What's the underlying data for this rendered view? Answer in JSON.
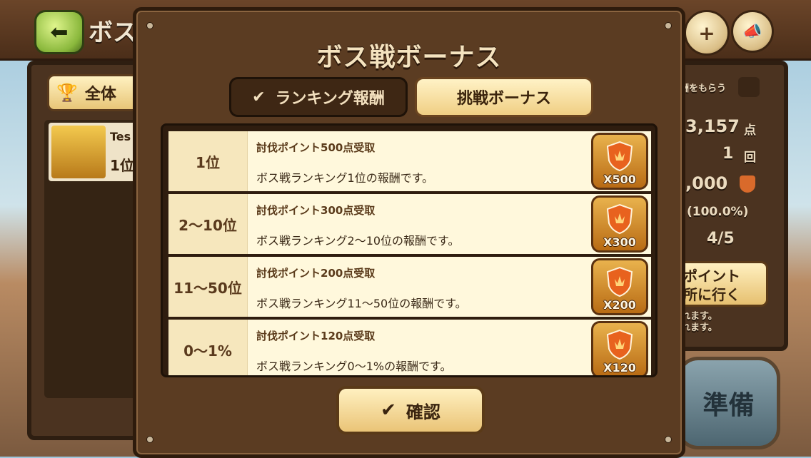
{
  "background": {
    "title_partial": "ボス",
    "left_tab_partial": "全体",
    "user_name_partial": "Tes",
    "user_rank_partial": "1位",
    "right_panel": {
      "receive_reward_partial": "酬をもらう",
      "score_partial": "3,157",
      "score_unit": "点",
      "count": "1",
      "count_unit": "回",
      "point_partial": ",000",
      "percent": "(100.0%)",
      "progress": "4/5",
      "goto_button_line1": "ポイント",
      "goto_button_line2": "所に行く",
      "note_line1": "れます。",
      "note_line2": "れます。"
    },
    "prepare_partial": "準備"
  },
  "modal": {
    "title": "ボス戦ボーナス",
    "tabs": [
      {
        "label": "ランキング報酬",
        "active": true
      },
      {
        "label": "挑戦ボーナス",
        "active": false
      }
    ],
    "rewards": [
      {
        "rank": "1位",
        "title": "討伐ポイント500点受取",
        "desc": "ボス戦ランキング1位の報酬です。",
        "multiplier": "X500"
      },
      {
        "rank": "2〜10位",
        "title": "討伐ポイント300点受取",
        "desc": "ボス戦ランキング2〜10位の報酬です。",
        "multiplier": "X300"
      },
      {
        "rank": "11〜50位",
        "title": "討伐ポイント200点受取",
        "desc": "ボス戦ランキング11〜50位の報酬です。",
        "multiplier": "X200"
      },
      {
        "rank": "0〜1%",
        "title": "討伐ポイント120点受取",
        "desc": "ボス戦ランキング0〜1%の報酬です。",
        "multiplier": "X120"
      }
    ],
    "confirm_label": "確認",
    "check_glyph": "✔"
  },
  "icons": {
    "back": "back-arrow-icon",
    "plus": "plus-icon",
    "megaphone": "megaphone-icon",
    "trophy": "trophy-icon",
    "shield": "shield-icon",
    "chest": "chest-icon"
  },
  "colors": {
    "frame": "#5b3c22",
    "accent": "#f0cf84",
    "shield_orange": "#e8621e"
  }
}
